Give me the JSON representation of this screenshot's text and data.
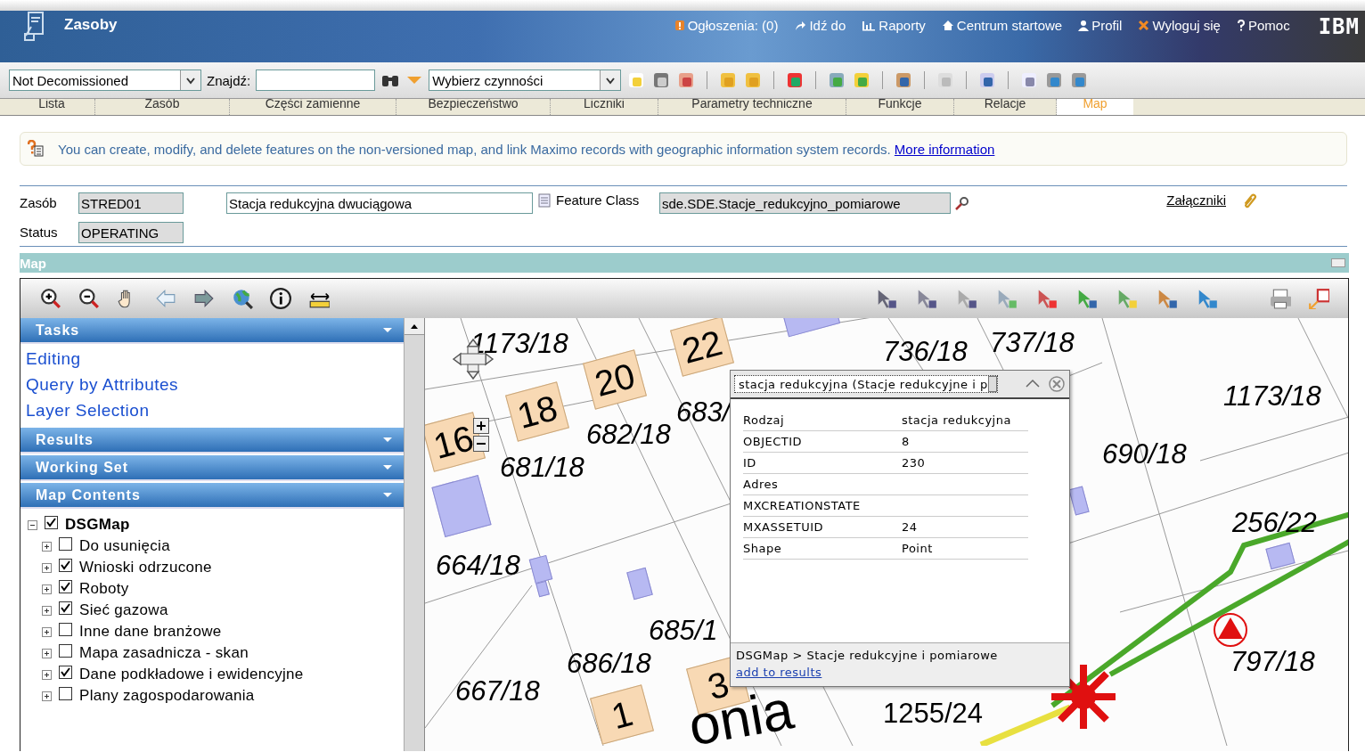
{
  "header": {
    "app_title": "Zasoby",
    "links": [
      {
        "label": "Ogłoszenia: (0)",
        "kind": "alert"
      },
      {
        "label": "Idź do",
        "kind": "goto"
      },
      {
        "label": "Raporty",
        "kind": "reports"
      },
      {
        "label": "Centrum startowe",
        "kind": "home"
      },
      {
        "label": "Profil",
        "kind": "profile"
      },
      {
        "label": "Wyloguj się",
        "kind": "logout"
      },
      {
        "label": "Pomoc",
        "kind": "help"
      }
    ],
    "logo": "IBM"
  },
  "toolbar": {
    "filter_value": "Not Decomissioned",
    "search_label": "Znajdź:",
    "action_select": "Wybierz czynności"
  },
  "tabs": [
    {
      "label": "Lista",
      "selected": false
    },
    {
      "label": "Zasób",
      "selected": false
    },
    {
      "label": "Części zamienne",
      "selected": false
    },
    {
      "label": "Bezpieczeństwo",
      "selected": false
    },
    {
      "label": "Liczniki",
      "selected": false
    },
    {
      "label": "Parametry techniczne",
      "selected": false
    },
    {
      "label": "Funkcje",
      "selected": false
    },
    {
      "label": "Relacje",
      "selected": false
    },
    {
      "label": "Map",
      "selected": true
    }
  ],
  "info": {
    "text": "You can create, modify, and delete features on the non-versioned map, and link Maximo records with geographic information system records.",
    "link": "More information"
  },
  "record": {
    "asset_label": "Zasób",
    "asset_value": "STRED01",
    "description_value": "Stacja redukcyjna dwuciągowa",
    "feature_class_label": "Feature Class",
    "feature_class_value": "sde.SDE.Stacje_redukcyjno_pomiarowe",
    "status_label": "Status",
    "status_value": "OPERATING",
    "attachments_link": "Załączniki"
  },
  "map_section": {
    "title": "Map"
  },
  "side_panel": {
    "sections": [
      {
        "title": "Tasks",
        "items": [
          "Editing",
          "Query by Attributes",
          "Layer Selection"
        ]
      },
      {
        "title": "Results"
      },
      {
        "title": "Working Set"
      },
      {
        "title": "Map Contents"
      }
    ],
    "map_contents": {
      "label": "DSGMap",
      "checked": true,
      "expanded": true,
      "children": [
        {
          "label": "Do usunięcia",
          "checked": false,
          "expanded": false
        },
        {
          "label": "Wnioski odrzucone",
          "checked": true,
          "expanded": false
        },
        {
          "label": "Roboty",
          "checked": true,
          "expanded": false
        },
        {
          "label": "Sieć gazowa",
          "checked": true,
          "expanded": false
        },
        {
          "label": "Inne dane branżowe",
          "checked": false,
          "expanded": false
        },
        {
          "label": "Mapa zasadnicza - skan",
          "checked": false,
          "expanded": false
        },
        {
          "label": "Dane podkładowe i ewidencyjne",
          "checked": true,
          "expanded": false
        },
        {
          "label": "Plany zagospodarowania",
          "checked": false,
          "expanded": false
        }
      ]
    }
  },
  "map": {
    "parcel_labels": [
      "1173/18",
      "737/18",
      "736/18",
      "1173/18",
      "690/18",
      "256/22",
      "797/18",
      "683/",
      "682/18",
      "681/18",
      "664/18",
      "685/1",
      "686/18",
      "667/18",
      "1255/24"
    ],
    "street_label": "onia",
    "building_numbers": [
      "22",
      "20",
      "18",
      "16",
      "3",
      "1"
    ],
    "popup": {
      "select_value": "stacja redukcyjna (Stacje redukcyjne i p",
      "rows": [
        {
          "key": "Rodzaj",
          "value": "stacja redukcyjna"
        },
        {
          "key": "OBJECTID",
          "value": "8"
        },
        {
          "key": "ID",
          "value": "230"
        },
        {
          "key": "Adres"
        },
        {
          "key": "MXCREATIONSTATE"
        },
        {
          "key": "MXASSETUID",
          "value": "24"
        },
        {
          "key": "Shape",
          "value": "Point"
        }
      ],
      "breadcrumb": "DSGMap > Stacje redukcyjne i pomiarowe",
      "link": "add to results"
    }
  }
}
